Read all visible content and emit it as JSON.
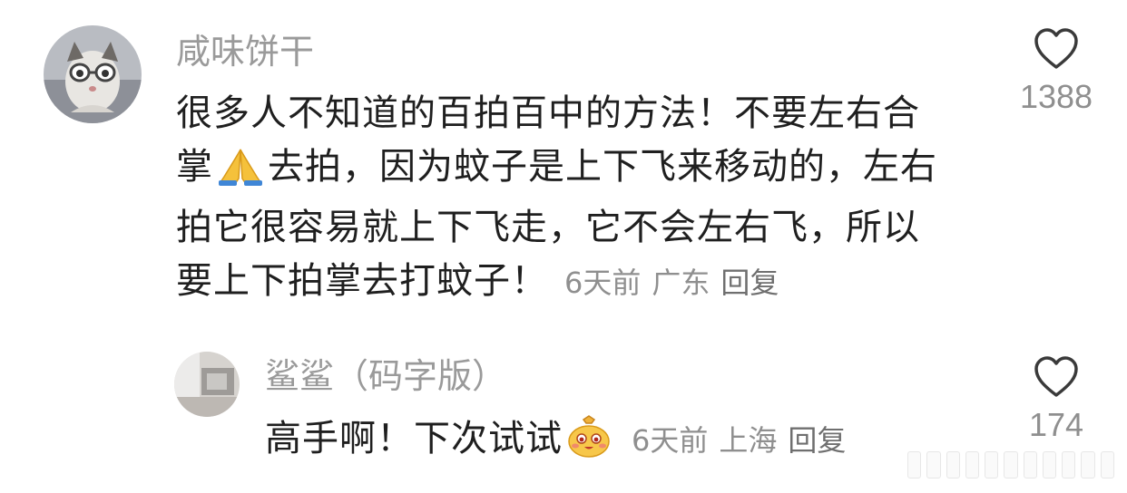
{
  "comment": {
    "username": "咸味饼干",
    "lines": [
      "很多人不知道的百拍百中的方法！不要左右合",
      "去拍，因为蚊子是上下飞来移动的，左右",
      "拍它很容易就上下飞走，它不会左右飞，所以",
      "要上下拍掌去打蚊子！"
    ],
    "line2_prefix": "掌",
    "inline_emoji": "folded-hands-icon",
    "time": "6天前",
    "location": "广东",
    "reply_label": "回复",
    "likes": "1388"
  },
  "reply": {
    "username": "鲨鲨（码字版）",
    "text": "高手啊！下次试试",
    "inline_emoji": "money-bag-smiling-icon",
    "time": "6天前",
    "location": "上海",
    "reply_label": "回复",
    "likes": "174"
  },
  "colors": {
    "username": "#9a9a9a",
    "text": "#1f1f1f",
    "meta": "#8f8f8f",
    "icon_stroke": "#3a3a3a"
  }
}
